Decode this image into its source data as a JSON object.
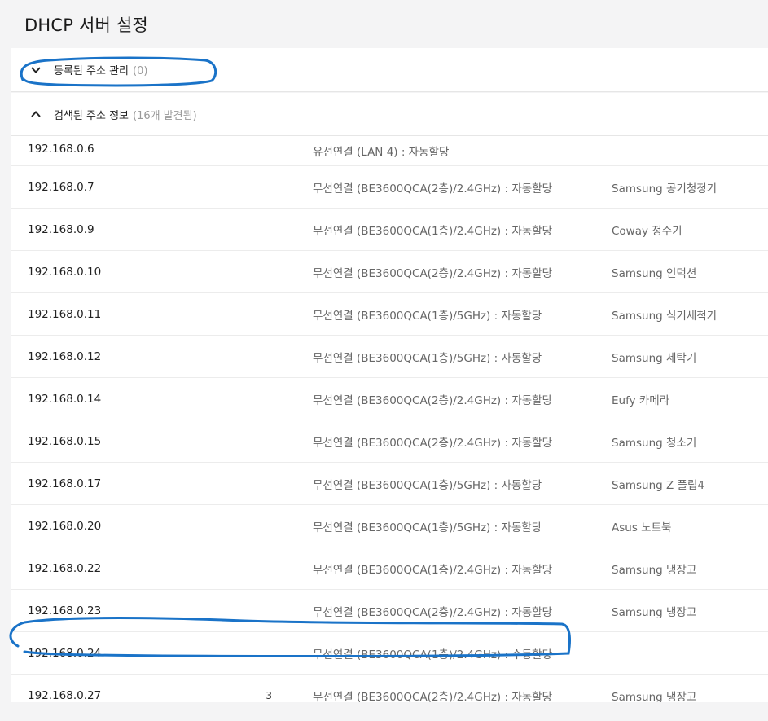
{
  "page": {
    "title": "DHCP 서버 설정"
  },
  "registered": {
    "label": "등록된 주소 관리",
    "count": "(0)"
  },
  "discovered": {
    "label": "검색된 주소 정보",
    "count": "(16개 발견됨)",
    "rows": [
      {
        "ip": "192.168.0.6",
        "mac": "",
        "conn": "유선연결 (LAN 4) : 자동할당",
        "name": ""
      },
      {
        "ip": "192.168.0.7",
        "mac": "",
        "conn": "무선연결 (BE3600QCA(2층)/2.4GHz) : 자동할당",
        "name": "Samsung 공기청정기"
      },
      {
        "ip": "192.168.0.9",
        "mac": "",
        "conn": "무선연결 (BE3600QCA(1층)/2.4GHz) : 자동할당",
        "name": "Coway 정수기"
      },
      {
        "ip": "192.168.0.10",
        "mac": "",
        "conn": "무선연결 (BE3600QCA(2층)/2.4GHz) : 자동할당",
        "name": "Samsung 인덕션"
      },
      {
        "ip": "192.168.0.11",
        "mac": "",
        "conn": "무선연결 (BE3600QCA(1층)/5GHz) : 자동할당",
        "name": "Samsung 식기세척기"
      },
      {
        "ip": "192.168.0.12",
        "mac": "",
        "conn": "무선연결 (BE3600QCA(1층)/5GHz) : 자동할당",
        "name": "Samsung 세탁기"
      },
      {
        "ip": "192.168.0.14",
        "mac": "",
        "conn": "무선연결 (BE3600QCA(2층)/2.4GHz) : 자동할당",
        "name": "Eufy 카메라"
      },
      {
        "ip": "192.168.0.15",
        "mac": "",
        "conn": "무선연결 (BE3600QCA(2층)/2.4GHz) : 자동할당",
        "name": "Samsung 청소기"
      },
      {
        "ip": "192.168.0.17",
        "mac": "",
        "conn": "무선연결 (BE3600QCA(1층)/5GHz) : 자동할당",
        "name": "Samsung Z 플립4"
      },
      {
        "ip": "192.168.0.20",
        "mac": "",
        "conn": "무선연결 (BE3600QCA(1층)/5GHz) : 자동할당",
        "name": "Asus 노트북"
      },
      {
        "ip": "192.168.0.22",
        "mac": "",
        "conn": "무선연결 (BE3600QCA(1층)/2.4GHz) : 자동할당",
        "name": "Samsung 냉장고"
      },
      {
        "ip": "192.168.0.23",
        "mac": "",
        "conn": "무선연결 (BE3600QCA(2층)/2.4GHz) : 자동할당",
        "name": "Samsung 냉장고"
      },
      {
        "ip": "192.168.0.24",
        "mac": "",
        "conn": "무선연결 (BE3600QCA(1층)/2.4GHz) : 수동할당",
        "name": ""
      },
      {
        "ip": "192.168.0.27",
        "mac": "3",
        "conn": "무선연결 (BE3600QCA(2층)/2.4GHz) : 자동할당",
        "name": "Samsung 냉장고"
      }
    ]
  },
  "colors": {
    "annotation": "#1a73c8",
    "background": "#f4f4f5",
    "panel": "#ffffff"
  }
}
